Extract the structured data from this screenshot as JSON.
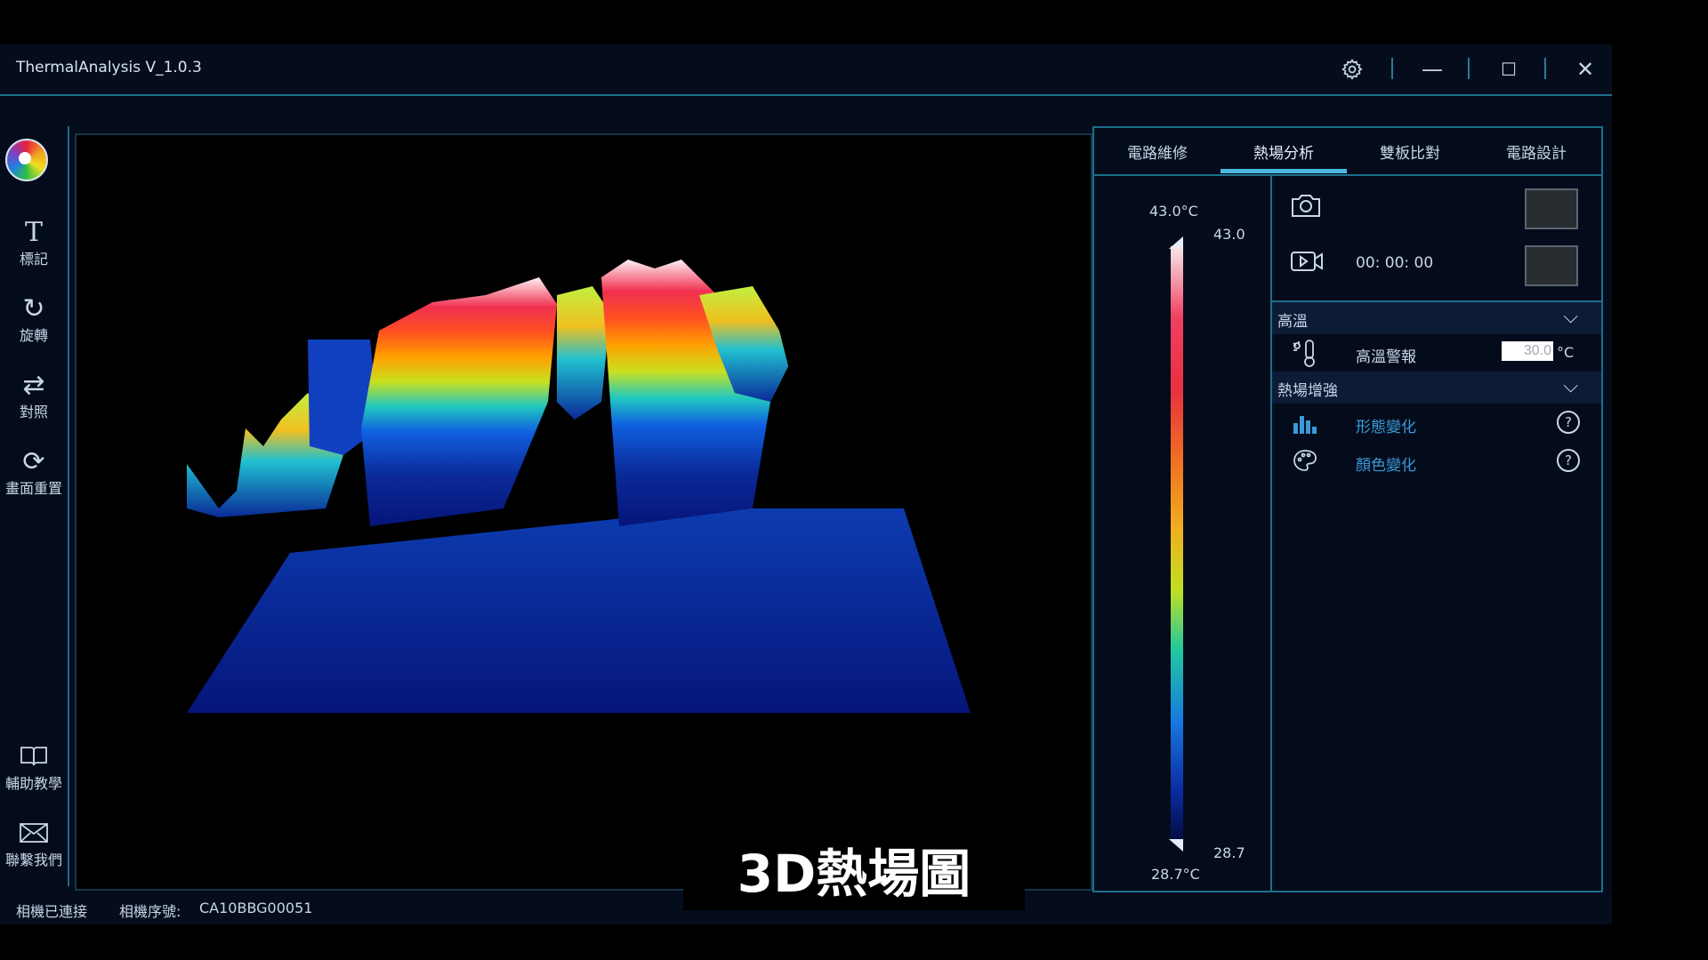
{
  "window": {
    "title": "ThermalAnalysis V_1.0.3",
    "controls": {
      "settings_icon": "gear-icon",
      "minimize": "—",
      "maximize": "☐",
      "close": "✕"
    }
  },
  "toolbar": {
    "items": [
      {
        "label": "標記",
        "icon": "text-icon"
      },
      {
        "label": "旋轉",
        "icon": "rotate-icon"
      },
      {
        "label": "對照",
        "icon": "swap-icon"
      },
      {
        "label": "畫面重置",
        "icon": "reset-icon"
      },
      {
        "label": "輔助教學",
        "icon": "book-icon"
      },
      {
        "label": "聯繫我們",
        "icon": "mail-icon"
      }
    ]
  },
  "tabs": [
    {
      "label": "電路維修"
    },
    {
      "label": "熱場分析",
      "active": true
    },
    {
      "label": "雙板比對"
    },
    {
      "label": "電路設計"
    }
  ],
  "legend": {
    "max_label": "43.0°C",
    "min_label": "28.7°C",
    "max_marker": "43.0",
    "min_marker": "28.7"
  },
  "controls": {
    "record_time": "00: 00: 00"
  },
  "sections": {
    "high_temp": {
      "header": "高溫",
      "alarm_label": "高溫警報",
      "alarm_value": "30.0",
      "alarm_unit": "°C"
    },
    "enhance": {
      "header": "熱場增強",
      "shape_label": "形態變化",
      "color_label": "顏色變化"
    }
  },
  "status": {
    "connection": "相機已連接",
    "serial_label": "相機序號:",
    "serial_value": "CA10BBG00051"
  },
  "caption": "3D熱場圖",
  "colors": {
    "background": "#040c1c",
    "accent": "#4db8e0",
    "border": "#1e6f8c"
  }
}
